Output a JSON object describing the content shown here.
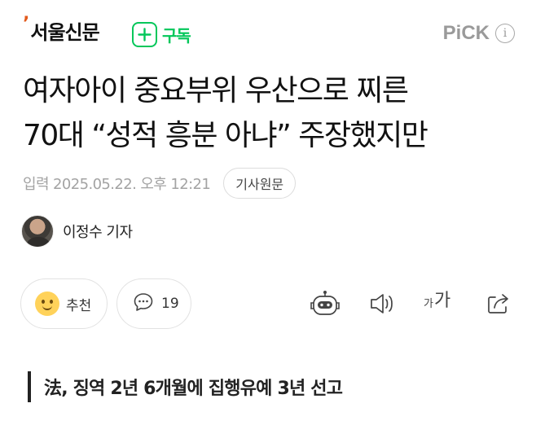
{
  "header": {
    "press_tick": "’",
    "press_name": "서울신문",
    "subscribe_label": "구독",
    "pick_label": "PiCK",
    "info_glyph": "i"
  },
  "article": {
    "title_line1": "여자아이 중요부위 우산으로 찌른",
    "title_line2": "70대 “성적 흥분 아냐” 주장했지만",
    "date": "입력 2025.05.22. 오후 12:21",
    "original_button": "기사원문",
    "reporter": "이정수 기자",
    "subheading": "法, 징역 2년 6개월에 집행유예 3년 선고"
  },
  "actions": {
    "like_label": "추천",
    "comment_count": "19",
    "font_small": "가",
    "font_big": "가"
  },
  "icons": [
    "smile-emoji-icon",
    "comment-icon",
    "ai-bot-icon",
    "speaker-icon",
    "font-size-icon",
    "share-icon",
    "plus-icon",
    "info-icon"
  ],
  "colors": {
    "accent_green": "#03c75a",
    "press_accent": "#e25a1c",
    "muted_text": "#a3a3a3"
  }
}
